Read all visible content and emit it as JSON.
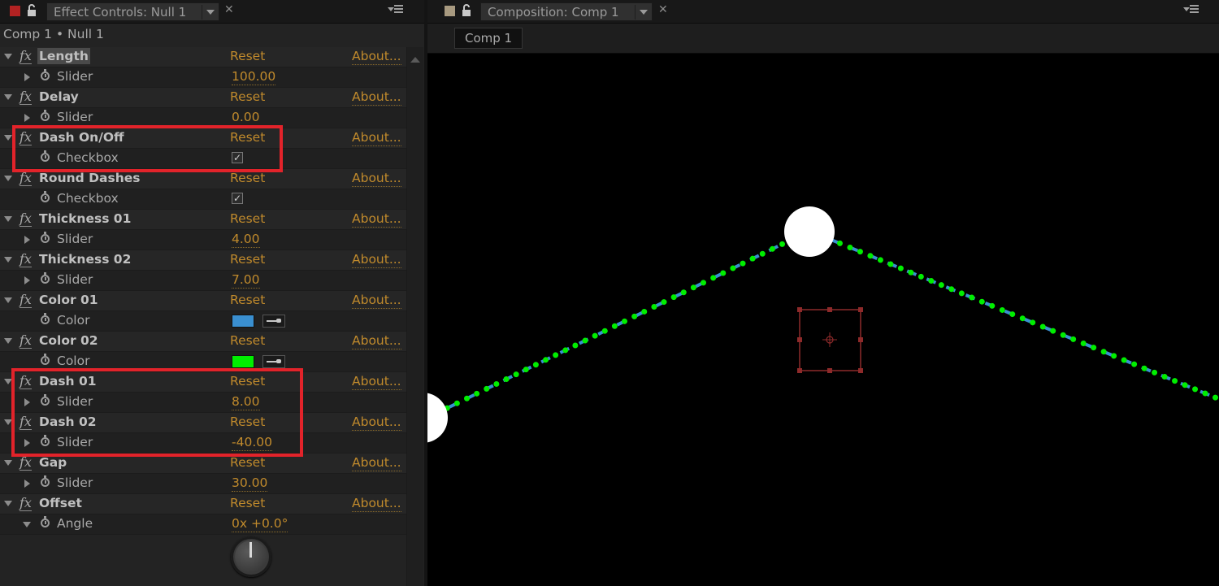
{
  "effect_controls": {
    "tab_label": "Effect Controls: Null 1",
    "breadcrumb": "Comp 1 • Null 1",
    "reset_label": "Reset",
    "about_label": "About...",
    "effects": [
      {
        "name": "Length",
        "param": "Slider",
        "value": "100.00",
        "kind": "slider"
      },
      {
        "name": "Delay",
        "param": "Slider",
        "value": "0.00",
        "kind": "slider"
      },
      {
        "name": "Dash On/Off",
        "param": "Checkbox",
        "value": "✓",
        "kind": "checkbox"
      },
      {
        "name": "Round Dashes",
        "param": "Checkbox",
        "value": "✓",
        "kind": "checkbox"
      },
      {
        "name": "Thickness 01",
        "param": "Slider",
        "value": "4.00",
        "kind": "slider"
      },
      {
        "name": "Thickness 02",
        "param": "Slider",
        "value": "7.00",
        "kind": "slider"
      },
      {
        "name": "Color 01",
        "param": "Color",
        "value": "#3a8fd0",
        "kind": "color"
      },
      {
        "name": "Color 02",
        "param": "Color",
        "value": "#00ee00",
        "kind": "color"
      },
      {
        "name": "Dash 01",
        "param": "Slider",
        "value": "8.00",
        "kind": "slider"
      },
      {
        "name": "Dash 02",
        "param": "Slider",
        "value": "-40.00",
        "kind": "slider"
      },
      {
        "name": "Gap",
        "param": "Slider",
        "value": "30.00",
        "kind": "slider"
      },
      {
        "name": "Offset",
        "param": "Angle",
        "value": "0x +0.0°",
        "kind": "angle"
      }
    ]
  },
  "composition": {
    "tab_label": "Composition: Comp 1",
    "comp_button": "Comp 1"
  },
  "colors": {
    "label_swatch_effect": "#b22222",
    "label_swatch_comp": "#a89a80",
    "accent_value": "#c08a2c",
    "highlight_box": "#e2232a",
    "dash_blue": "#3a8fd0",
    "dash_green": "#00ee00"
  }
}
